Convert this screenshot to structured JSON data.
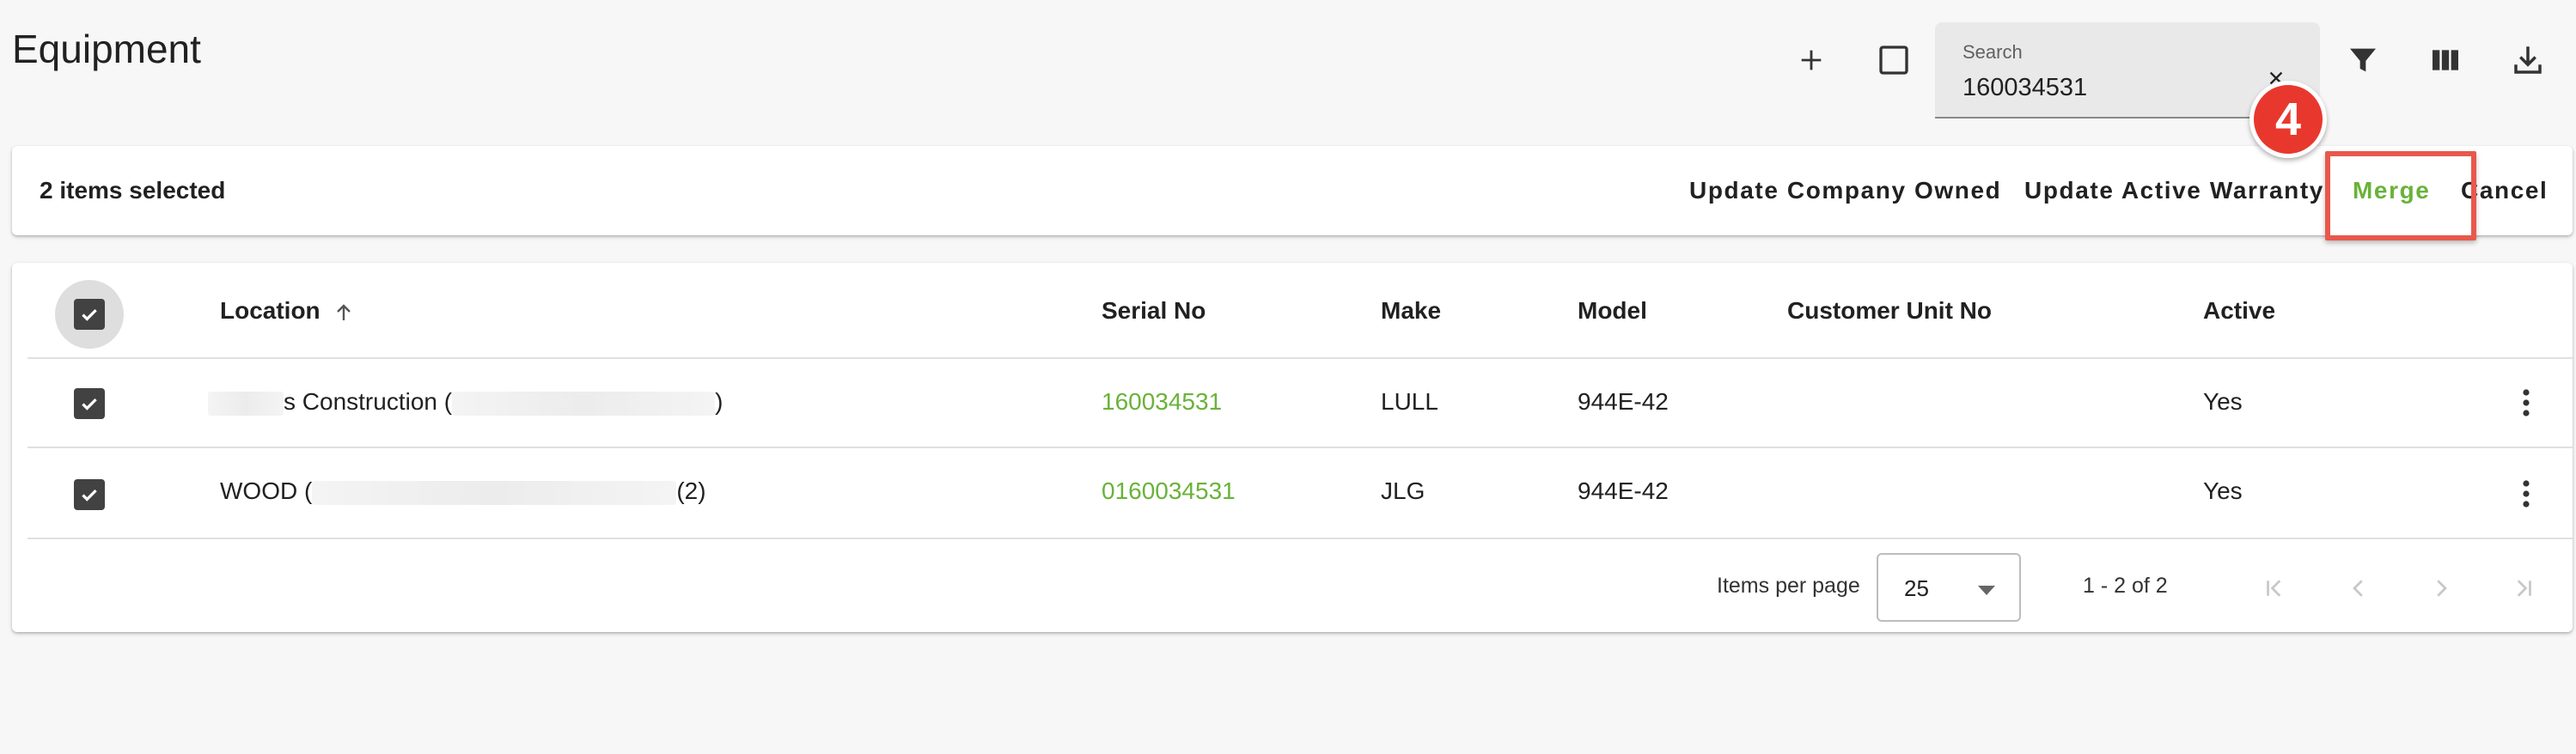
{
  "page": {
    "title": "Equipment"
  },
  "toolbar": {
    "add_icon": "plus-icon",
    "select_icon": "checkbox-outline-icon",
    "filter_icon": "filter-icon",
    "columns_icon": "columns-icon",
    "download_icon": "download-icon"
  },
  "search": {
    "label": "Search",
    "value": "160034531",
    "clear_icon": "close-icon"
  },
  "selection_bar": {
    "count_text": "2 items selected",
    "actions": {
      "update_company_owned": "Update Company Owned",
      "update_active_warranty": "Update Active Warranty",
      "merge": "Merge",
      "cancel": "Cancel"
    }
  },
  "annotation": {
    "step": "4",
    "color": "#e8382e",
    "highlight_color": "#e8584c"
  },
  "table": {
    "columns": {
      "location": "Location",
      "serial_no": "Serial No",
      "make": "Make",
      "model": "Model",
      "customer_unit_no": "Customer Unit No",
      "active": "Active"
    },
    "rows": [
      {
        "selected": true,
        "location_prefix": "",
        "location_visible": "s Construction (",
        "location_suffix": ")",
        "serial_no": "160034531",
        "make": "LULL",
        "model": "944E-42",
        "customer_unit_no": "",
        "active": "Yes"
      },
      {
        "selected": true,
        "location_prefix": "WOOD (",
        "location_visible": "",
        "location_suffix": "(2)",
        "serial_no": "0160034531",
        "make": "JLG",
        "model": "944E-42",
        "customer_unit_no": "",
        "active": "Yes"
      }
    ]
  },
  "paginator": {
    "items_per_page_label": "Items per page",
    "page_size": "25",
    "range": "1 - 2 of 2"
  },
  "colors": {
    "accent_green": "#6ab23a",
    "text": "#212121",
    "background": "#f7f7f7"
  }
}
